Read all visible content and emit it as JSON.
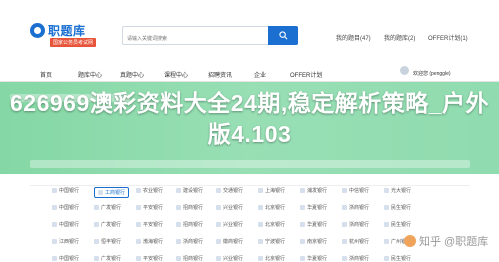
{
  "header": {
    "logo_text": "职题库",
    "logo_tag": "国家公务员考试网",
    "search_placeholder": "请输入关键词搜索",
    "links": [
      "我的题目(47)",
      "我的题库(2)",
      "OFFER计划(1)"
    ]
  },
  "nav": {
    "items": [
      "首页",
      "题库中心",
      "真题中心",
      "课程中心",
      "招聘资讯",
      "企业",
      "OFFER计划"
    ],
    "user_text": "欢迎您 (penggle)"
  },
  "banner": {
    "headline": "626969澳彩资料大全24期,稳定解析策略_户外版4.103"
  },
  "grid": {
    "rows": [
      [
        "中国银行",
        "工商银行",
        "农业银行",
        "建设银行",
        "交通银行",
        "上海银行",
        "浦发银行",
        "中信银行",
        "光大银行"
      ],
      [
        "中国银行",
        "广发银行",
        "平安银行",
        "招商银行",
        "兴业银行",
        "北京银行",
        "华夏银行",
        "浙商银行",
        "民生银行"
      ],
      [
        "中国银行",
        "广发银行",
        "平安银行",
        "招商银行",
        "兴业银行",
        "北京银行",
        "华夏银行",
        "浙商银行",
        "民生银行"
      ],
      [
        "江西银行",
        "恒丰银行",
        "渤海银行",
        "浙商银行",
        "徽商银行",
        "宁波银行",
        "南京银行",
        "杭州银行",
        "广州银行"
      ],
      [
        "中国银行",
        "广发银行",
        "平安银行",
        "招商银行",
        "兴业银行",
        "北京银行",
        "华夏银行",
        "浙商银行",
        "民生银行"
      ]
    ],
    "active_cell": "工商银行"
  },
  "watermark": {
    "text": "知乎 @职题库"
  },
  "colors": {
    "brand": "#1a6fd1",
    "banner": "#86d8a8"
  }
}
